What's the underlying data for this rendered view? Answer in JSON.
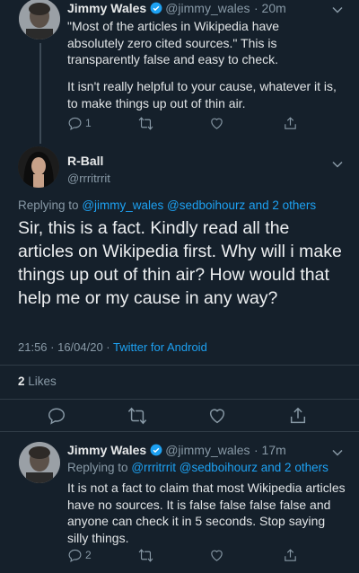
{
  "tweet1": {
    "name": "Jimmy Wales",
    "handle": "@jimmy_wales",
    "time": "· 20m",
    "text_p1": "\"Most of the articles in Wikipedia have absolutely zero cited sources.\"  This is transparently false and easy to check.",
    "text_p2": "It isn't really helpful to your cause, whatever it is, to make things up out of thin air.",
    "reply_count": "1",
    "retweet_count": "",
    "like_count": ""
  },
  "tweet2": {
    "name": "R-Ball",
    "handle": "@rrritrrit",
    "replying_prefix": "Replying to",
    "replying_users": "@jimmy_wales @sedboihourz",
    "replying_suffix": "and 2 others",
    "text": "Sir, this is a fact. Kindly read all the articles on Wikipedia first. Why will i make things up out of thin air? How would that help me or my cause in any way?",
    "timestamp": "21:56 · 16/04/20 ·",
    "client": "Twitter for Android",
    "likes_count": "2",
    "likes_label": "Likes"
  },
  "tweet3": {
    "name": "Jimmy Wales",
    "handle": "@jimmy_wales",
    "time": "· 17m",
    "replying_prefix": "Replying to",
    "replying_users": "@rrritrrit @sedboihourz",
    "replying_suffix": "and 2 others",
    "text": "It is not a fact to claim that most Wikipedia articles have no sources.  It is false false false false and anyone can check it in 5 seconds.  Stop saying silly things.",
    "reply_count": "2"
  },
  "colors": {
    "background": "#15202b",
    "link": "#1da1f2",
    "muted": "#8899a6",
    "verified": "#1da1f2"
  }
}
